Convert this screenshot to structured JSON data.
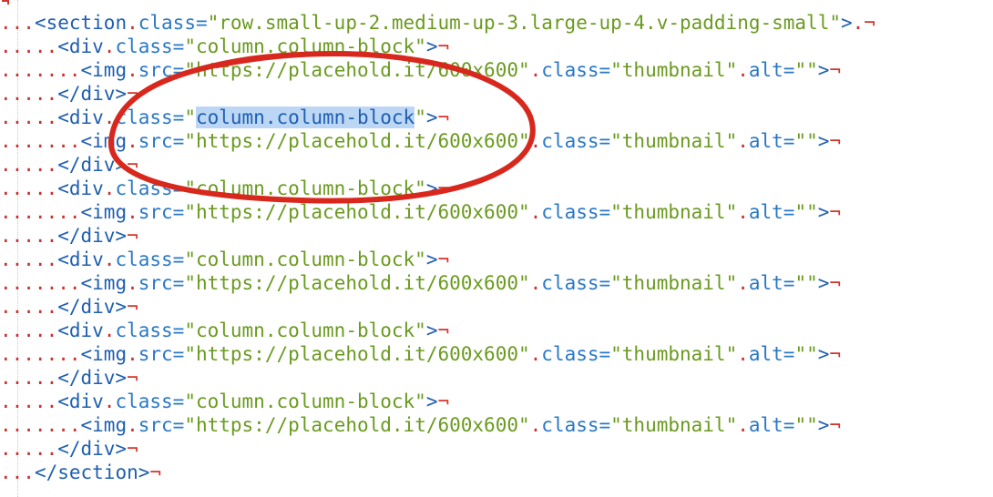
{
  "code": {
    "lines": [
      {
        "pre": "...",
        "parts": [
          [
            "tag",
            "<section"
          ],
          [
            "ws",
            "."
          ],
          [
            "attr",
            "class="
          ],
          [
            "str",
            "\"row.small-up-2.medium-up-3.large-up-4.v-padding-small\""
          ],
          [
            "tag",
            ">"
          ],
          [
            "ws",
            "."
          ]
        ],
        "eol": "¬"
      },
      {
        "pre": ".....",
        "parts": [
          [
            "tag",
            "<div"
          ],
          [
            "ws",
            "."
          ],
          [
            "attr",
            "class="
          ],
          [
            "str",
            "\"column.column-block\""
          ],
          [
            "tag",
            ">"
          ]
        ],
        "eol": "¬"
      },
      {
        "pre": ".......",
        "parts": [
          [
            "tag",
            "<img"
          ],
          [
            "ws",
            "."
          ],
          [
            "attr",
            "src="
          ],
          [
            "str",
            "\"https://placehold.it/600x600\""
          ],
          [
            "ws",
            "."
          ],
          [
            "attr",
            "class="
          ],
          [
            "str",
            "\"thumbnail\""
          ],
          [
            "ws",
            "."
          ],
          [
            "attr",
            "alt="
          ],
          [
            "str",
            "\"\""
          ],
          [
            "tag",
            ">"
          ]
        ],
        "eol": "¬"
      },
      {
        "pre": ".....",
        "parts": [
          [
            "tag",
            "</div>"
          ]
        ],
        "eol": "¬"
      },
      {
        "pre": ".....",
        "parts": [
          [
            "tag",
            "<div"
          ],
          [
            "ws",
            "."
          ],
          [
            "attr",
            "class="
          ],
          [
            "str",
            "\""
          ],
          [
            "sel",
            "column.column-block"
          ],
          [
            "str",
            "\""
          ],
          [
            "tag",
            ">"
          ]
        ],
        "eol": "¬"
      },
      {
        "pre": ".......",
        "parts": [
          [
            "tag",
            "<img"
          ],
          [
            "ws",
            "."
          ],
          [
            "attr",
            "src="
          ],
          [
            "str",
            "\"https://placehold.it/600x600\""
          ],
          [
            "ws",
            "."
          ],
          [
            "attr",
            "class="
          ],
          [
            "str",
            "\"thumbnail\""
          ],
          [
            "ws",
            "."
          ],
          [
            "attr",
            "alt="
          ],
          [
            "str",
            "\"\""
          ],
          [
            "tag",
            ">"
          ]
        ],
        "eol": "¬"
      },
      {
        "pre": ".....",
        "parts": [
          [
            "tag",
            "</div>"
          ]
        ],
        "eol": "¬"
      },
      {
        "pre": ".....",
        "parts": [
          [
            "tag",
            "<div"
          ],
          [
            "ws",
            "."
          ],
          [
            "attr",
            "class="
          ],
          [
            "str",
            "\"column.column-block\""
          ],
          [
            "tag",
            ">"
          ]
        ],
        "eol": "¬"
      },
      {
        "pre": ".......",
        "parts": [
          [
            "tag",
            "<img"
          ],
          [
            "ws",
            "."
          ],
          [
            "attr",
            "src="
          ],
          [
            "str",
            "\"https://placehold.it/600x600\""
          ],
          [
            "ws",
            "."
          ],
          [
            "attr",
            "class="
          ],
          [
            "str",
            "\"thumbnail\""
          ],
          [
            "ws",
            "."
          ],
          [
            "attr",
            "alt="
          ],
          [
            "str",
            "\"\""
          ],
          [
            "tag",
            ">"
          ]
        ],
        "eol": "¬"
      },
      {
        "pre": ".....",
        "parts": [
          [
            "tag",
            "</div>"
          ]
        ],
        "eol": "¬"
      },
      {
        "pre": ".....",
        "parts": [
          [
            "tag",
            "<div"
          ],
          [
            "ws",
            "."
          ],
          [
            "attr",
            "class="
          ],
          [
            "str",
            "\"column.column-block\""
          ],
          [
            "tag",
            ">"
          ]
        ],
        "eol": "¬"
      },
      {
        "pre": ".......",
        "parts": [
          [
            "tag",
            "<img"
          ],
          [
            "ws",
            "."
          ],
          [
            "attr",
            "src="
          ],
          [
            "str",
            "\"https://placehold.it/600x600\""
          ],
          [
            "ws",
            "."
          ],
          [
            "attr",
            "class="
          ],
          [
            "str",
            "\"thumbnail\""
          ],
          [
            "ws",
            "."
          ],
          [
            "attr",
            "alt="
          ],
          [
            "str",
            "\"\""
          ],
          [
            "tag",
            ">"
          ]
        ],
        "eol": "¬"
      },
      {
        "pre": ".....",
        "parts": [
          [
            "tag",
            "</div>"
          ]
        ],
        "eol": "¬"
      },
      {
        "pre": ".....",
        "parts": [
          [
            "tag",
            "<div"
          ],
          [
            "ws",
            "."
          ],
          [
            "attr",
            "class="
          ],
          [
            "str",
            "\"column.column-block\""
          ],
          [
            "tag",
            ">"
          ]
        ],
        "eol": "¬"
      },
      {
        "pre": ".......",
        "parts": [
          [
            "tag",
            "<img"
          ],
          [
            "ws",
            "."
          ],
          [
            "attr",
            "src="
          ],
          [
            "str",
            "\"https://placehold.it/600x600\""
          ],
          [
            "ws",
            "."
          ],
          [
            "attr",
            "class="
          ],
          [
            "str",
            "\"thumbnail\""
          ],
          [
            "ws",
            "."
          ],
          [
            "attr",
            "alt="
          ],
          [
            "str",
            "\"\""
          ],
          [
            "tag",
            ">"
          ]
        ],
        "eol": "¬"
      },
      {
        "pre": ".....",
        "parts": [
          [
            "tag",
            "</div>"
          ]
        ],
        "eol": "¬"
      },
      {
        "pre": ".....",
        "parts": [
          [
            "tag",
            "<div"
          ],
          [
            "ws",
            "."
          ],
          [
            "attr",
            "class="
          ],
          [
            "str",
            "\"column.column-block\""
          ],
          [
            "tag",
            ">"
          ]
        ],
        "eol": "¬"
      },
      {
        "pre": ".......",
        "parts": [
          [
            "tag",
            "<img"
          ],
          [
            "ws",
            "."
          ],
          [
            "attr",
            "src="
          ],
          [
            "str",
            "\"https://placehold.it/600x600\""
          ],
          [
            "ws",
            "."
          ],
          [
            "attr",
            "class="
          ],
          [
            "str",
            "\"thumbnail\""
          ],
          [
            "ws",
            "."
          ],
          [
            "attr",
            "alt="
          ],
          [
            "str",
            "\"\""
          ],
          [
            "tag",
            ">"
          ]
        ],
        "eol": "¬"
      },
      {
        "pre": ".....",
        "parts": [
          [
            "tag",
            "</div>"
          ]
        ],
        "eol": "¬"
      },
      {
        "pre": "...",
        "parts": [
          [
            "tag",
            "</section>"
          ]
        ],
        "eol": "¬"
      }
    ]
  },
  "colors": {
    "tag": "#1f5fb0",
    "attribute": "#2a78c6",
    "string": "#6a9a1f",
    "whitespace_marker": "#c9302c",
    "selection": "#bcd7f5",
    "annotation_ellipse": "#d8281e"
  }
}
